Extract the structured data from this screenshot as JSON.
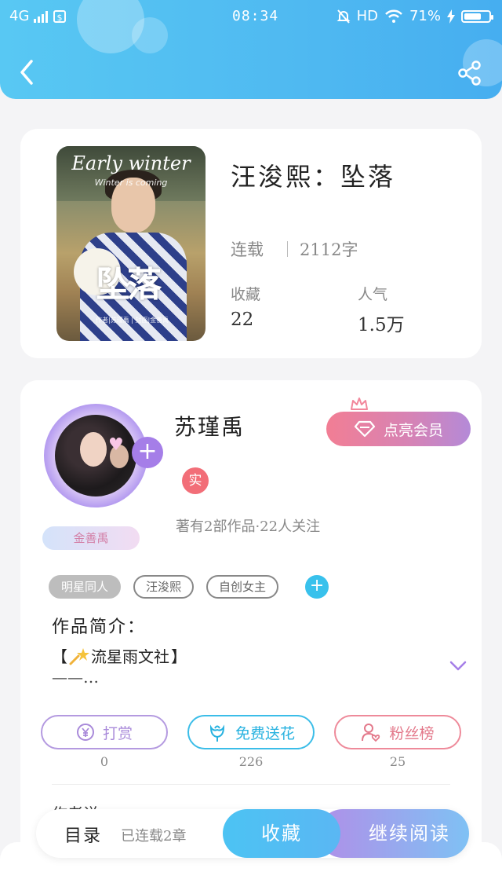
{
  "status_bar": {
    "network": "4G",
    "time": "08:34",
    "hd": "HD",
    "battery": "71%",
    "battery_level": 0.71
  },
  "book": {
    "cover_title": "Early winter",
    "cover_subtitle": "Winter is coming",
    "cover_big_text": "坠落",
    "cover_caption": "作者|苏瑾禹 | 封面|金善禹",
    "title": "汪浚熙：坠落",
    "status": "连载",
    "word_count": "2112字",
    "favorites_label": "收藏",
    "favorites_value": "22",
    "popularity_label": "人气",
    "popularity_value": "1.5万"
  },
  "author": {
    "name": "苏瑾禹",
    "vip_button": "点亮会员",
    "real_badge": "实",
    "tag": "金善禹",
    "meta": "著有2部作品·22人关注"
  },
  "tags": [
    "明星同人",
    "汪浚熙",
    "自创女主"
  ],
  "intro": {
    "title": "作品简介：",
    "line1_prefix": "【",
    "line1_text": "流星雨文社",
    "line1_suffix": "】",
    "line2": "——…"
  },
  "actions": [
    {
      "label": "打赏",
      "count": "0",
      "color": "#b49ae0",
      "icon": "yen-coin-icon"
    },
    {
      "label": "免费送花",
      "count": "226",
      "color": "#3bbde8",
      "icon": "flower-icon"
    },
    {
      "label": "粉丝榜",
      "count": "25",
      "color": "#ee8a9a",
      "icon": "fan-user-icon"
    }
  ],
  "partial_text": "作者说",
  "bottom": {
    "toc": "目录",
    "chapters": "已连载2章",
    "favorite": "收藏",
    "continue": "继续阅读"
  },
  "colors": {
    "header": "#4fb9f1",
    "accent_blue": "#38c1ec",
    "accent_purple": "#a57ee8",
    "vip_pink": "#f27e94"
  }
}
